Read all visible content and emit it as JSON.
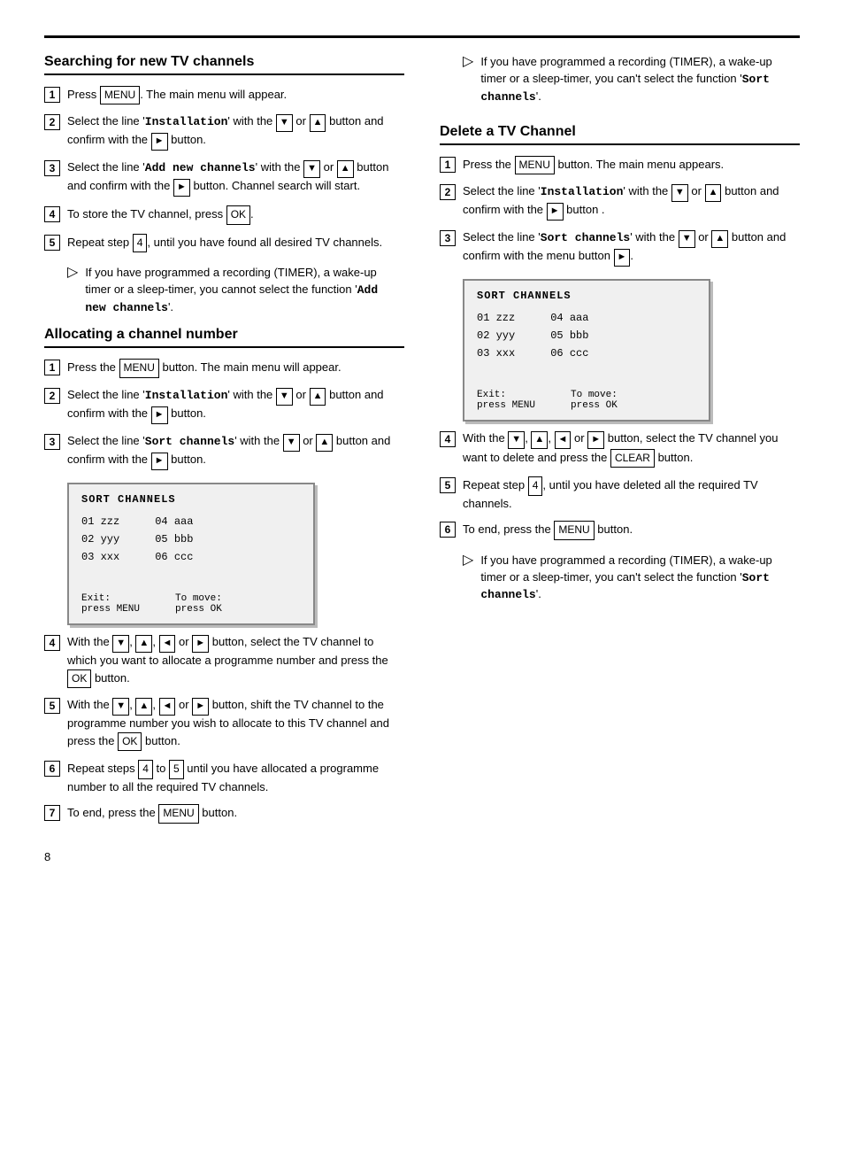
{
  "top_rule": true,
  "left_column": {
    "section1": {
      "title": "Searching for new TV channels",
      "steps": [
        {
          "num": "1",
          "text": "Press {MENU}. The main menu will appear."
        },
        {
          "num": "2",
          "text": "Select the line '{Installation}' with the {down} or {up} button and confirm with the {right} button."
        },
        {
          "num": "3",
          "text": "Select the line '{Add new channels}' with the {down} or {up} button and confirm with the {right} button. Channel search will start."
        },
        {
          "num": "4",
          "text": "To store the TV channel, press {OK}."
        },
        {
          "num": "5",
          "text": "Repeat step {4},  until you have found all desired TV channels."
        }
      ],
      "note": "If you have programmed a recording (TIMER), a wake-up timer or a sleep-timer, you cannot select the function '{Add new channels}'."
    },
    "section2": {
      "title": "Allocating a channel number",
      "steps": [
        {
          "num": "1",
          "text": "Press the {MENU} button. The main menu will appear."
        },
        {
          "num": "2",
          "text": "Select the line '{Installation}' with the {down} or {up} button and confirm with the {right} button."
        },
        {
          "num": "3",
          "text": "Select the line '{Sort channels}' with the {down} or {up} button and confirm with the {right} button."
        }
      ],
      "sort_channels": {
        "title": "SORT CHANNELS",
        "col1": [
          "01 zzz",
          "02 yyy",
          "03 xxx"
        ],
        "col2": [
          "04 aaa",
          "05 bbb",
          "06 ccc"
        ],
        "exit_label": "Exit:",
        "exit_val": "press MENU",
        "move_label": "To move:",
        "move_val": "press OK"
      },
      "steps2": [
        {
          "num": "4",
          "text": "With the {down}, {up}, {left} or {right} button, select the TV channel to which you want to allocate a programme number and press the {OK} button."
        },
        {
          "num": "5",
          "text": "With the {down}, {up}, {left} or {right} button, shift the TV channel to the programme number you wish to allocate to this TV channel and press the {OK} button."
        },
        {
          "num": "6",
          "text": "Repeat steps {4} to {5} until you have allocated a programme number to all the required TV channels."
        },
        {
          "num": "7",
          "text": "To end, press the {MENU} button."
        }
      ]
    }
  },
  "right_column": {
    "top_note": "If you have programmed a recording (TIMER), a wake-up timer or a sleep-timer, you can't select the function '‘Sort channels’'.",
    "section3": {
      "title": "Delete a TV Channel",
      "steps": [
        {
          "num": "1",
          "text": "Press the {MENU} button. The main menu appears."
        },
        {
          "num": "2",
          "text": "Select the line '{Installation}' with the {down} or {up} button and confirm with the {right} button ."
        },
        {
          "num": "3",
          "text": "Select the line '{Sort channels}' with the {down} or {up} button and confirm with the menu button {right}."
        }
      ],
      "sort_channels": {
        "title": "SORT CHANNELS",
        "col1": [
          "01 zzz",
          "02 yyy",
          "03 xxx"
        ],
        "col2": [
          "04 aaa",
          "05 bbb",
          "06 ccc"
        ],
        "exit_label": "Exit:",
        "exit_val": "press MENU",
        "move_label": "To move:",
        "move_val": "press OK"
      },
      "steps2": [
        {
          "num": "4",
          "text": "With the {down}, {up}, {left} or {right} button, select the TV channel you want to delete and press the {CLEAR} button."
        },
        {
          "num": "5",
          "text": "Repeat step {4},  until you have deleted all the required TV channels."
        },
        {
          "num": "6",
          "text": "To end, press the {MENU} button."
        }
      ],
      "note": "If you have programmed a recording (TIMER), a wake-up timer or a sleep-timer, you can't select the function '‘Sort channels’'."
    }
  },
  "page_number": "8"
}
